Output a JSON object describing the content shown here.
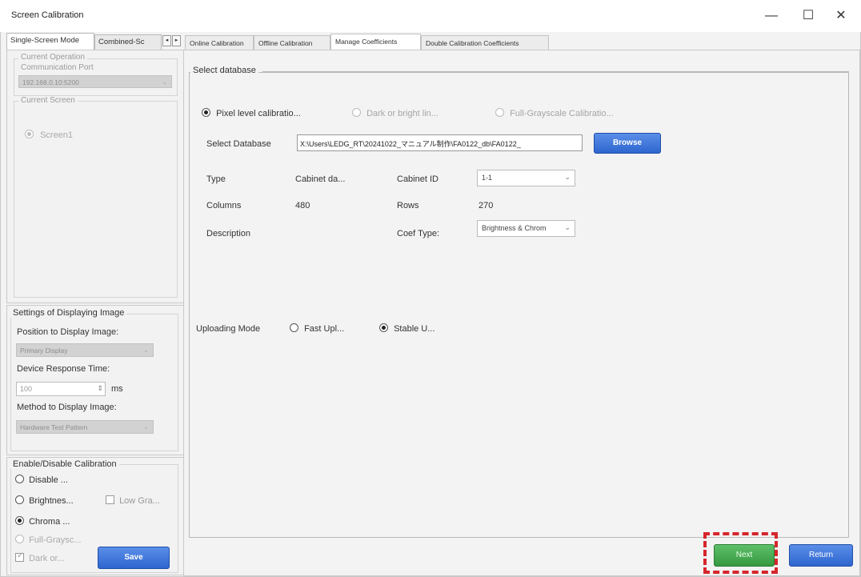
{
  "window": {
    "title": "Screen Calibration",
    "minimize": "—",
    "maximize": "☐",
    "close": "✕"
  },
  "left_tabs": [
    "Single-Screen Mode",
    "Combined-Sc"
  ],
  "left_tab_arrows": [
    "◂",
    "▸"
  ],
  "current_operation": {
    "legend": "Current Operation",
    "port_label": "Communication Port",
    "port_value": "192.168.0.10:5200",
    "dropdown_arrow": "⌄"
  },
  "current_screen": {
    "legend": "Current Screen",
    "screen_label": "Screen1"
  },
  "display_settings": {
    "legend": "Settings of Displaying Image",
    "position_label": "Position to Display Image:",
    "position_value": "Primary Display",
    "response_label": "Device Response Time:",
    "response_value": "100",
    "response_unit": "ms",
    "method_label": "Method to Display Image:",
    "method_value": "Hardware Test Pattern",
    "spinner": "⇕"
  },
  "calibration": {
    "legend": "Enable/Disable Calibration",
    "disable": "Disable ...",
    "brightness": "Brightnes...",
    "low_gray": "Low Gra...",
    "chroma": "Chroma ...",
    "full_gray": "Full-Graysc...",
    "dark": "Dark or...",
    "save": "Save"
  },
  "right_tabs": [
    "Online Calibration",
    "Offline Calibration",
    "Manage Coefficients",
    "Double Calibration Coefficients"
  ],
  "select_db": {
    "legend": "Select database",
    "mode_pixel": "Pixel level calibratio...",
    "mode_dark": "Dark or bright lin...",
    "mode_full": "Full-Grayscale Calibratio...",
    "db_label": "Select Database",
    "db_path": "X:\\Users\\LEDG_RT\\20241022_マニュアル制作\\FA0122_db\\FA0122_",
    "browse": "Browse",
    "type_label": "Type",
    "type_value": "Cabinet da...",
    "cabinet_id_label": "Cabinet ID",
    "cabinet_id_value": "1-1",
    "columns_label": "Columns",
    "columns_value": "480",
    "rows_label": "Rows",
    "rows_value": "270",
    "description_label": "Description",
    "coef_type_label": "Coef Type:",
    "coef_type_value": "Brightness & Chrom",
    "select_arrow": "⌄",
    "upload_label": "Uploading Mode",
    "upload_fast": "Fast Upl...",
    "upload_stable": "Stable U..."
  },
  "footer": {
    "next": "Next",
    "return": "Return"
  }
}
